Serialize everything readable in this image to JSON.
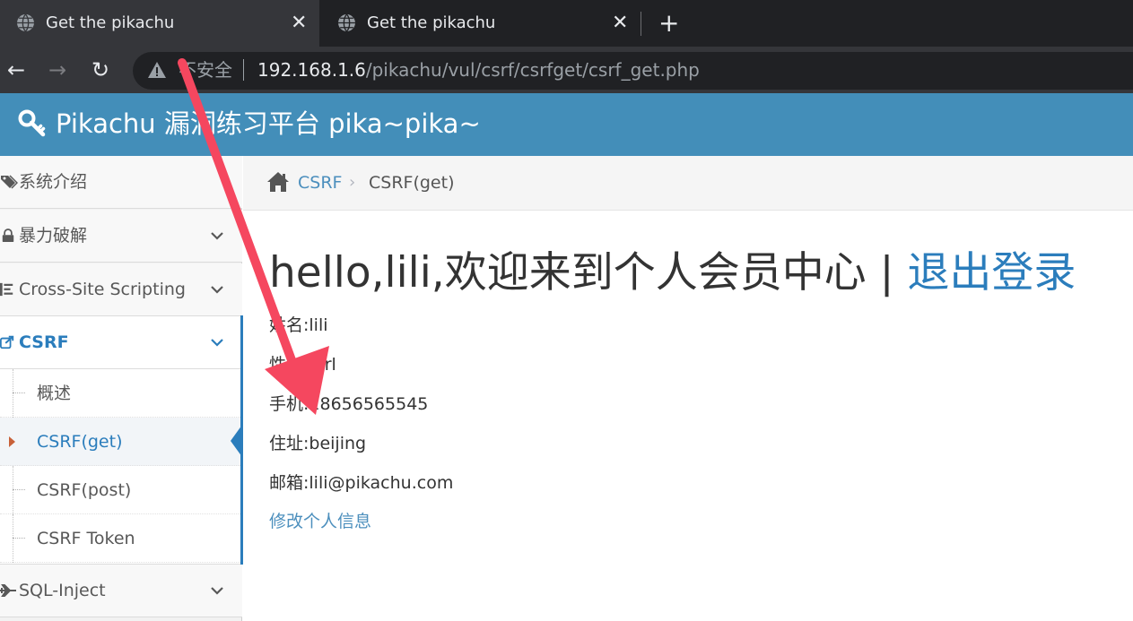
{
  "browser": {
    "tabs": [
      {
        "title": "Get the pikachu",
        "active": true
      },
      {
        "title": "Get the pikachu",
        "active": false
      }
    ],
    "new_tab_glyph": "+",
    "close_glyph": "✕",
    "nav": {
      "back": "←",
      "forward": "→",
      "reload": "↻"
    },
    "omnibox": {
      "security_label": "不安全",
      "url_host": "192.168.1.6",
      "url_path": "/pikachu/vul/csrf/csrfget/csrf_get.php"
    }
  },
  "site": {
    "title": "Pikachu 漏洞练习平台 pika~pika~",
    "header_color": "#438eb9"
  },
  "sidebar": {
    "items": [
      {
        "label": "系统介绍",
        "icon": "tags-icon",
        "has_chevron": false
      },
      {
        "label": "暴力破解",
        "icon": "lock-icon",
        "has_chevron": true
      },
      {
        "label": "Cross-Site Scripting",
        "icon": "list-icon",
        "has_chevron": true
      },
      {
        "label": "CSRF",
        "icon": "share-icon",
        "has_chevron": true,
        "open": true
      },
      {
        "label": "SQL-Inject",
        "icon": "plane-icon",
        "has_chevron": true
      }
    ],
    "csrf_subitems": [
      {
        "label": "概述",
        "active": false
      },
      {
        "label": "CSRF(get)",
        "active": true
      },
      {
        "label": "CSRF(post)",
        "active": false
      },
      {
        "label": "CSRF Token",
        "active": false
      }
    ]
  },
  "breadcrumb": {
    "home_icon": "home-icon",
    "link": "CSRF",
    "separator": "›",
    "current": "CSRF(get)"
  },
  "main": {
    "greeting": "hello,lili,欢迎来到个人会员中心 | ",
    "logout": "退出登录",
    "fields": [
      {
        "label": "姓名:",
        "value": "lili"
      },
      {
        "label": "性别:",
        "value": "girl"
      },
      {
        "label": "手机:",
        "value": "18656565545"
      },
      {
        "label": "住址:",
        "value": "beijing"
      },
      {
        "label": "邮箱:",
        "value": "lili@pikachu.com"
      }
    ],
    "edit_link": "修改个人信息"
  },
  "colors": {
    "accent": "#2b7dbc",
    "annotation_arrow": "#f5475f"
  }
}
